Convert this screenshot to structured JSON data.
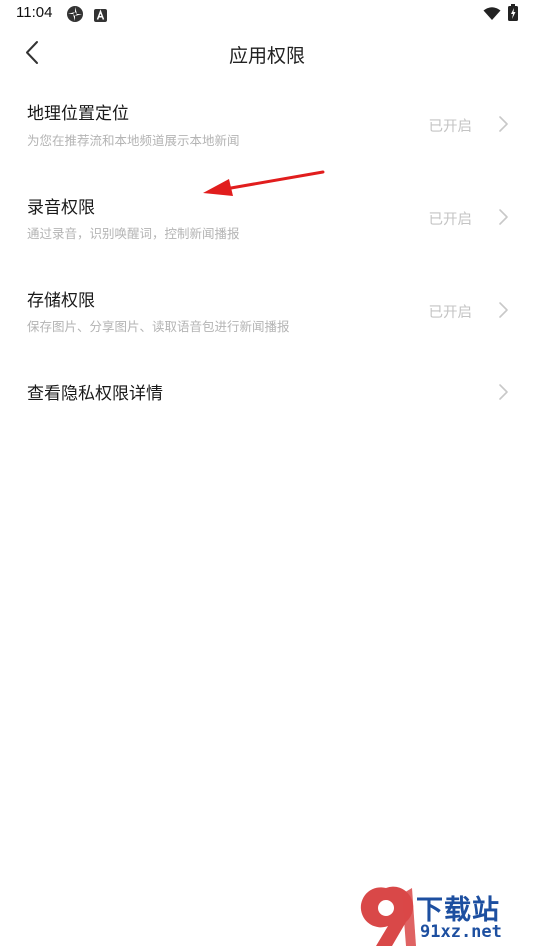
{
  "status_bar": {
    "time": "11:04",
    "icons": [
      "pinwheel-icon",
      "a-badge-icon",
      "wifi-icon",
      "battery-charging-icon"
    ]
  },
  "header": {
    "title": "应用权限",
    "back_icon": "chevron-left-icon"
  },
  "permissions": [
    {
      "title": "地理位置定位",
      "desc": "为您在推荐流和本地频道展示本地新闻",
      "status": "已开启"
    },
    {
      "title": "录音权限",
      "desc": "通过录音，识别唤醒词，控制新闻播报",
      "status": "已开启"
    },
    {
      "title": "存储权限",
      "desc": "保存图片、分享图片、读取语音包进行新闻播报",
      "status": "已开启"
    }
  ],
  "privacy_link": {
    "title": "查看隐私权限详情"
  },
  "watermark": {
    "text": "下载站",
    "url": "91xz.net"
  },
  "colors": {
    "annotation": "#e11d1d",
    "watermark": "#1d4fa0",
    "secondary_text": "#b4b4b4"
  }
}
